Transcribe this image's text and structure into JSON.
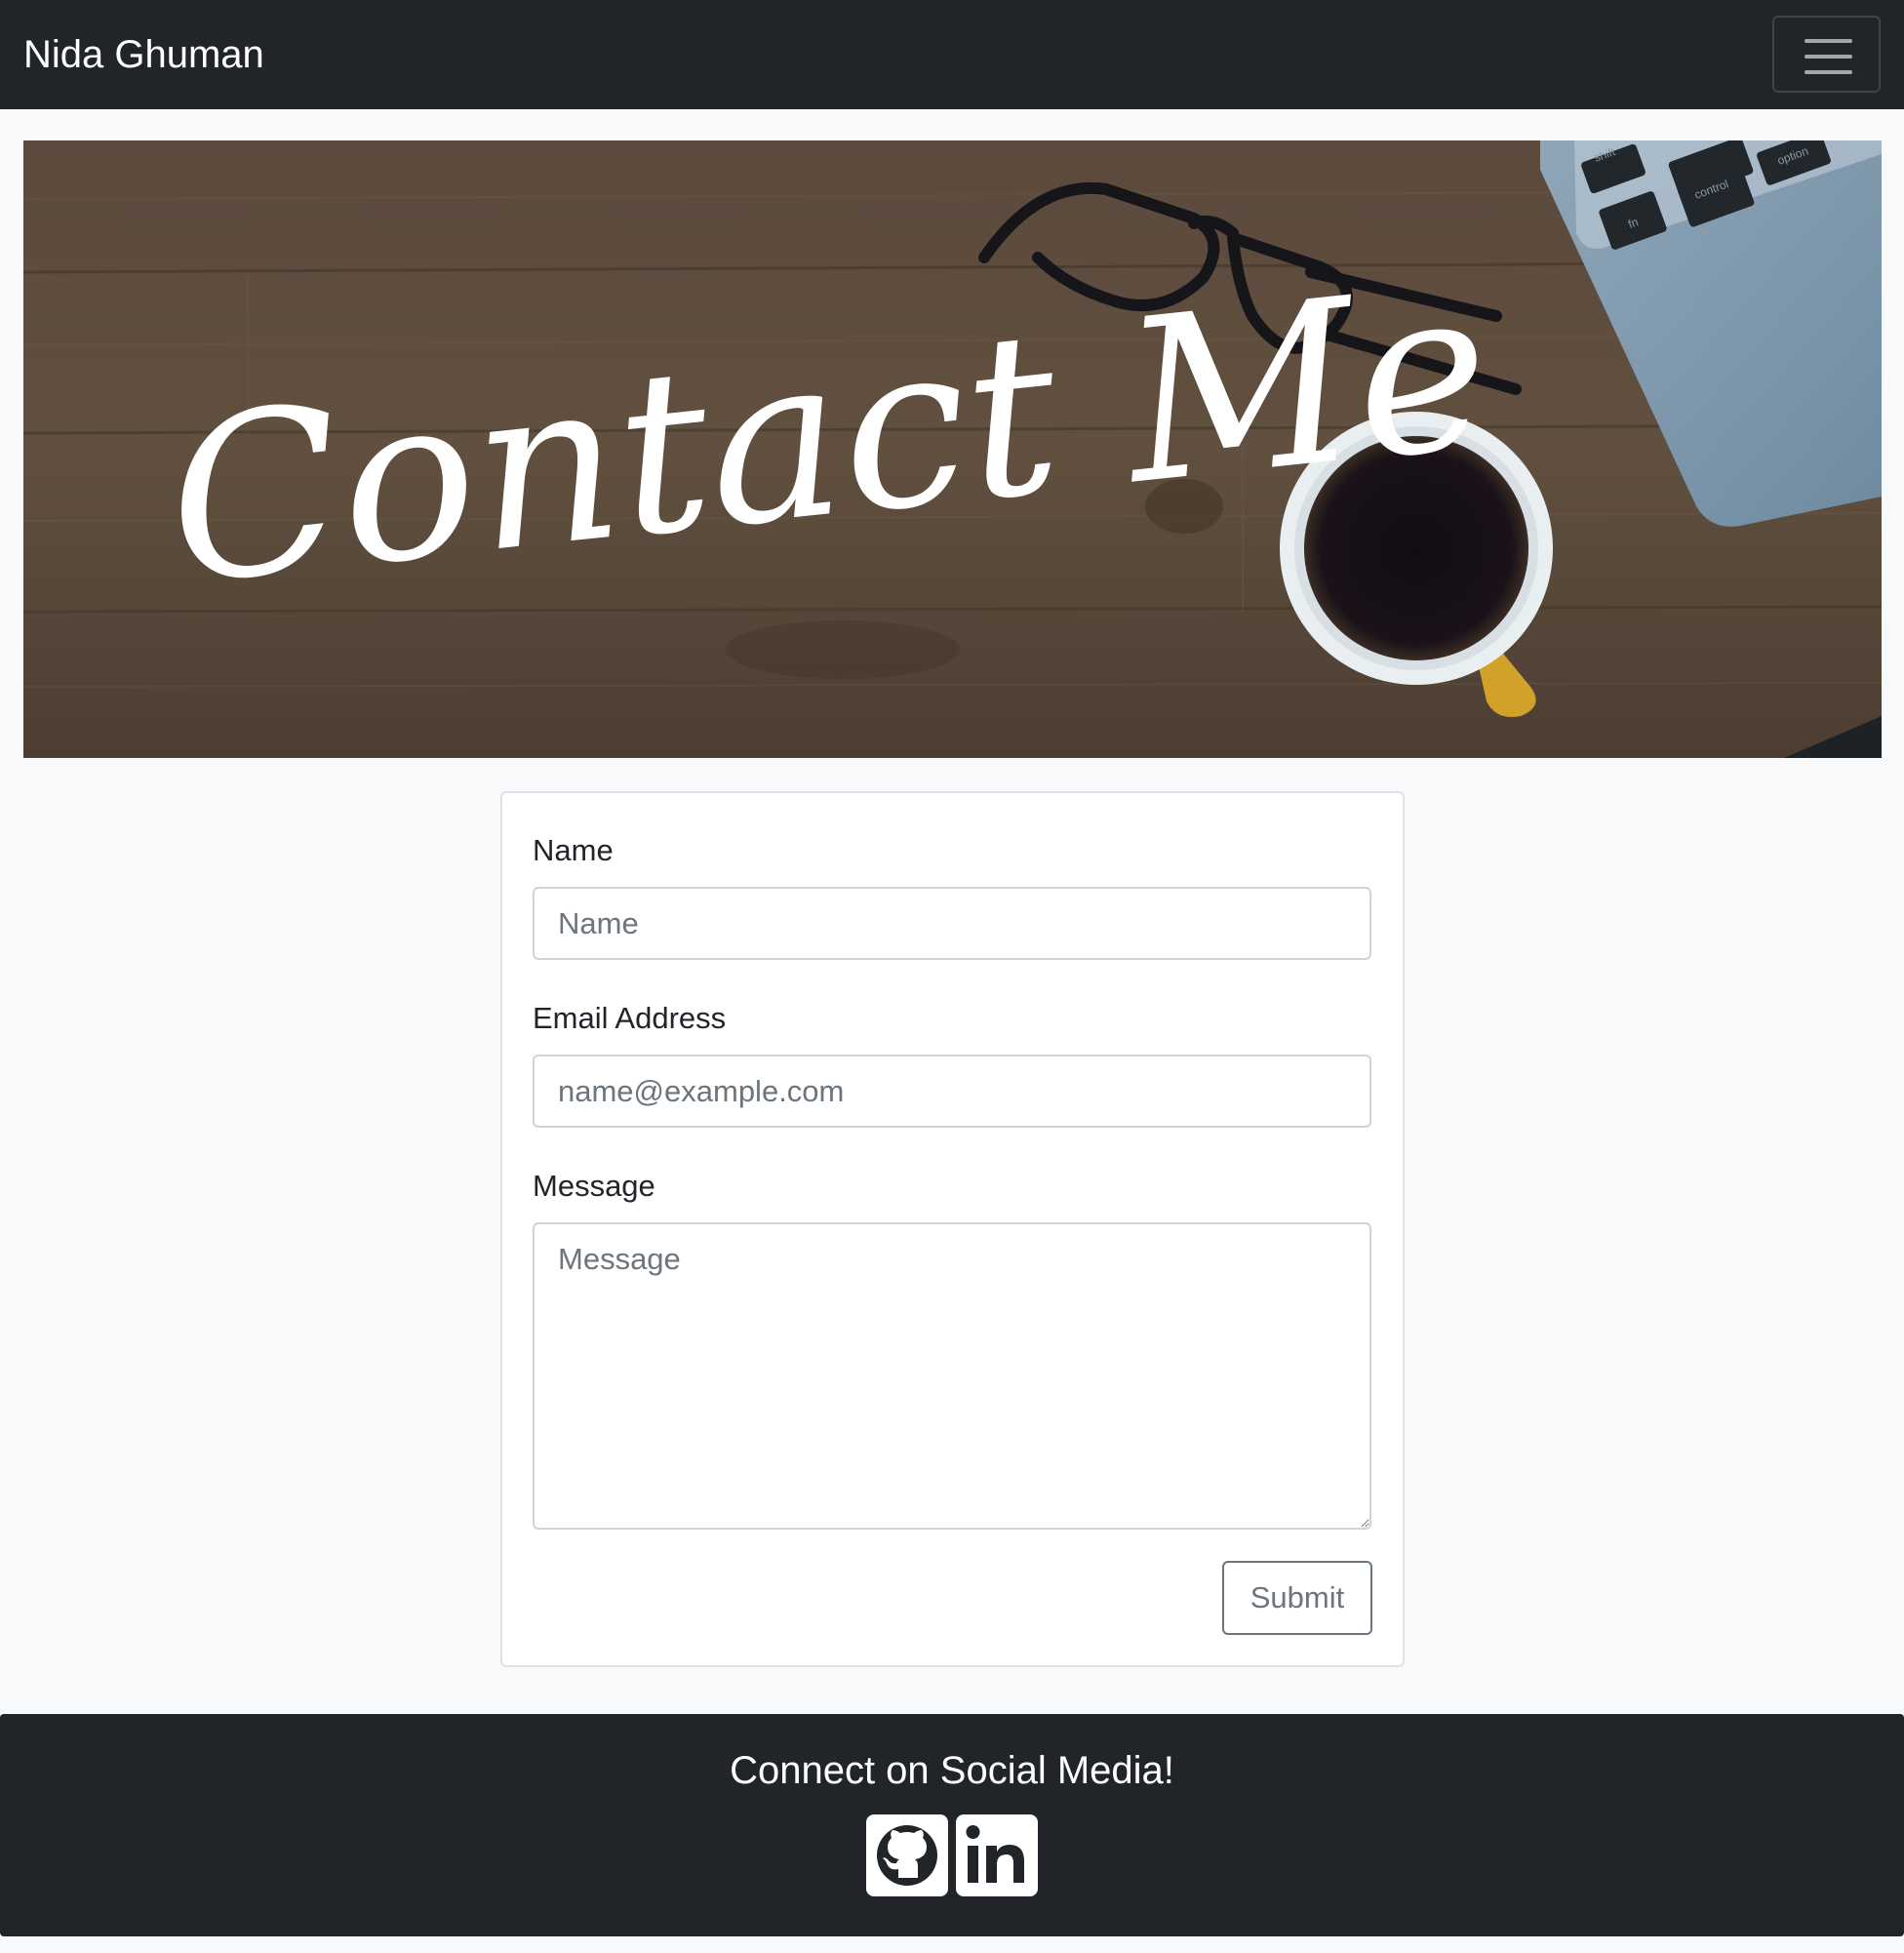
{
  "navbar": {
    "brand": "Nida Ghuman",
    "toggler_icon": "hamburger-menu-icon"
  },
  "banner": {
    "heading": "Contact Me",
    "keyboard_keys": [
      "shift",
      "control",
      "option",
      "fn"
    ]
  },
  "form": {
    "name_label": "Name",
    "name_placeholder": "Name",
    "email_label": "Email Address",
    "email_placeholder": "name@example.com",
    "message_label": "Message",
    "message_placeholder": "Message",
    "submit_label": "Submit"
  },
  "footer": {
    "title": "Connect on Social Media!",
    "links": [
      {
        "icon": "github-icon"
      },
      {
        "icon": "linkedin-icon"
      }
    ]
  },
  "colors": {
    "navbar_bg": "#212529",
    "page_bg": "#f8f9fa",
    "wood": "#5a4a3c",
    "submit_border": "#6c757d"
  }
}
